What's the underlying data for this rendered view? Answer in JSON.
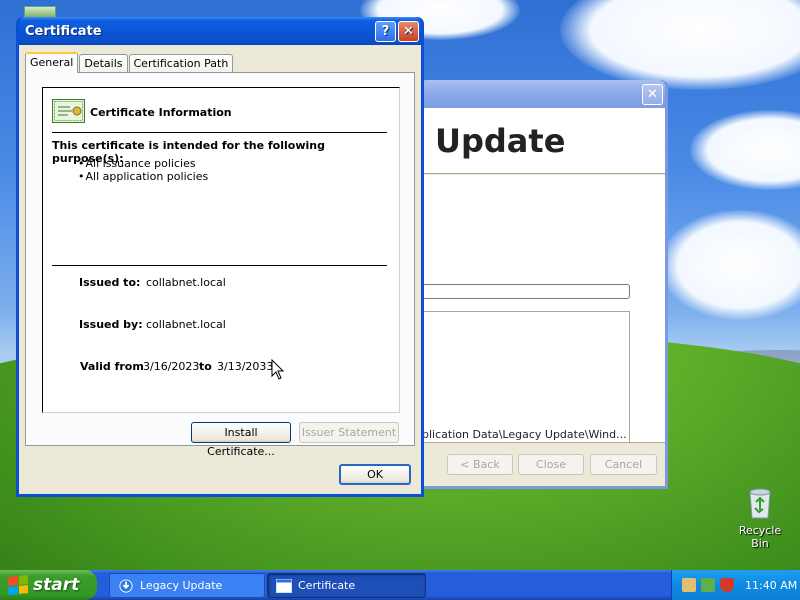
{
  "desktop": {
    "recycle_bin_label": "Recycle Bin"
  },
  "background_window": {
    "heading": "Update",
    "log_text": "plication Data\\Legacy Update\\Wind...",
    "buttons": {
      "back": "< Back",
      "close": "Close",
      "cancel": "Cancel"
    }
  },
  "certificate_window": {
    "title": "Certificate",
    "tabs": [
      "General",
      "Details",
      "Certification Path"
    ],
    "active_tab": "General",
    "info_heading": "Certificate Information",
    "purpose_title": "This certificate is intended for the following purpose(s):",
    "purposes": [
      "All issuance policies",
      "All application policies"
    ],
    "issued_to_label": "Issued to:",
    "issued_to_value": "collabnet.local",
    "issued_by_label": "Issued by:",
    "issued_by_value": "collabnet.local",
    "valid_from_label": "Valid from",
    "valid_from_value": "3/16/2023",
    "valid_to_label": "to",
    "valid_to_value": "3/13/2033",
    "install_button": "Install Certificate...",
    "issuer_statement_button": "Issuer Statement",
    "ok_button": "OK"
  },
  "taskbar": {
    "start_label": "start",
    "tasks": [
      "Legacy Update",
      "Certificate"
    ],
    "active_task": "Certificate",
    "clock": "11:40 AM"
  },
  "colors": {
    "titlebar_active": "#0a53d3",
    "titlebar_inactive": "#8aa8e8",
    "start_green": "#339a26",
    "taskbar_blue": "#245edb",
    "dialog_face": "#ece9d8"
  }
}
